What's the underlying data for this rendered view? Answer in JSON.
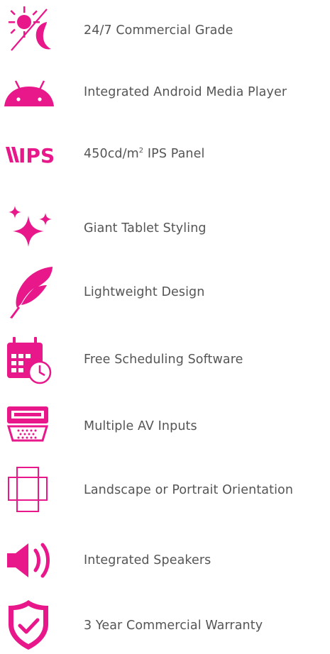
{
  "accent_color": "#E8178A",
  "features": [
    {
      "icon": "sun-moon-icon",
      "label": "24/7 Commercial Grade"
    },
    {
      "icon": "android-icon",
      "label": "Integrated Android Media Player"
    },
    {
      "icon": "ips-icon",
      "icon_text": "IPS",
      "label_prefix": "450cd/m",
      "label_sup": "2",
      "label_suffix": " IPS Panel"
    },
    {
      "icon": "sparkles-icon",
      "label": "Giant Tablet Styling"
    },
    {
      "icon": "feather-icon",
      "label": "Lightweight Design"
    },
    {
      "icon": "calendar-clock-icon",
      "label": "Free Scheduling Software"
    },
    {
      "icon": "av-ports-icon",
      "label": "Multiple AV Inputs"
    },
    {
      "icon": "orientation-icon",
      "label": "Landscape or Portrait Orientation"
    },
    {
      "icon": "speaker-icon",
      "label": "Integrated Speakers"
    },
    {
      "icon": "shield-check-icon",
      "label": "3 Year Commercial Warranty"
    }
  ]
}
